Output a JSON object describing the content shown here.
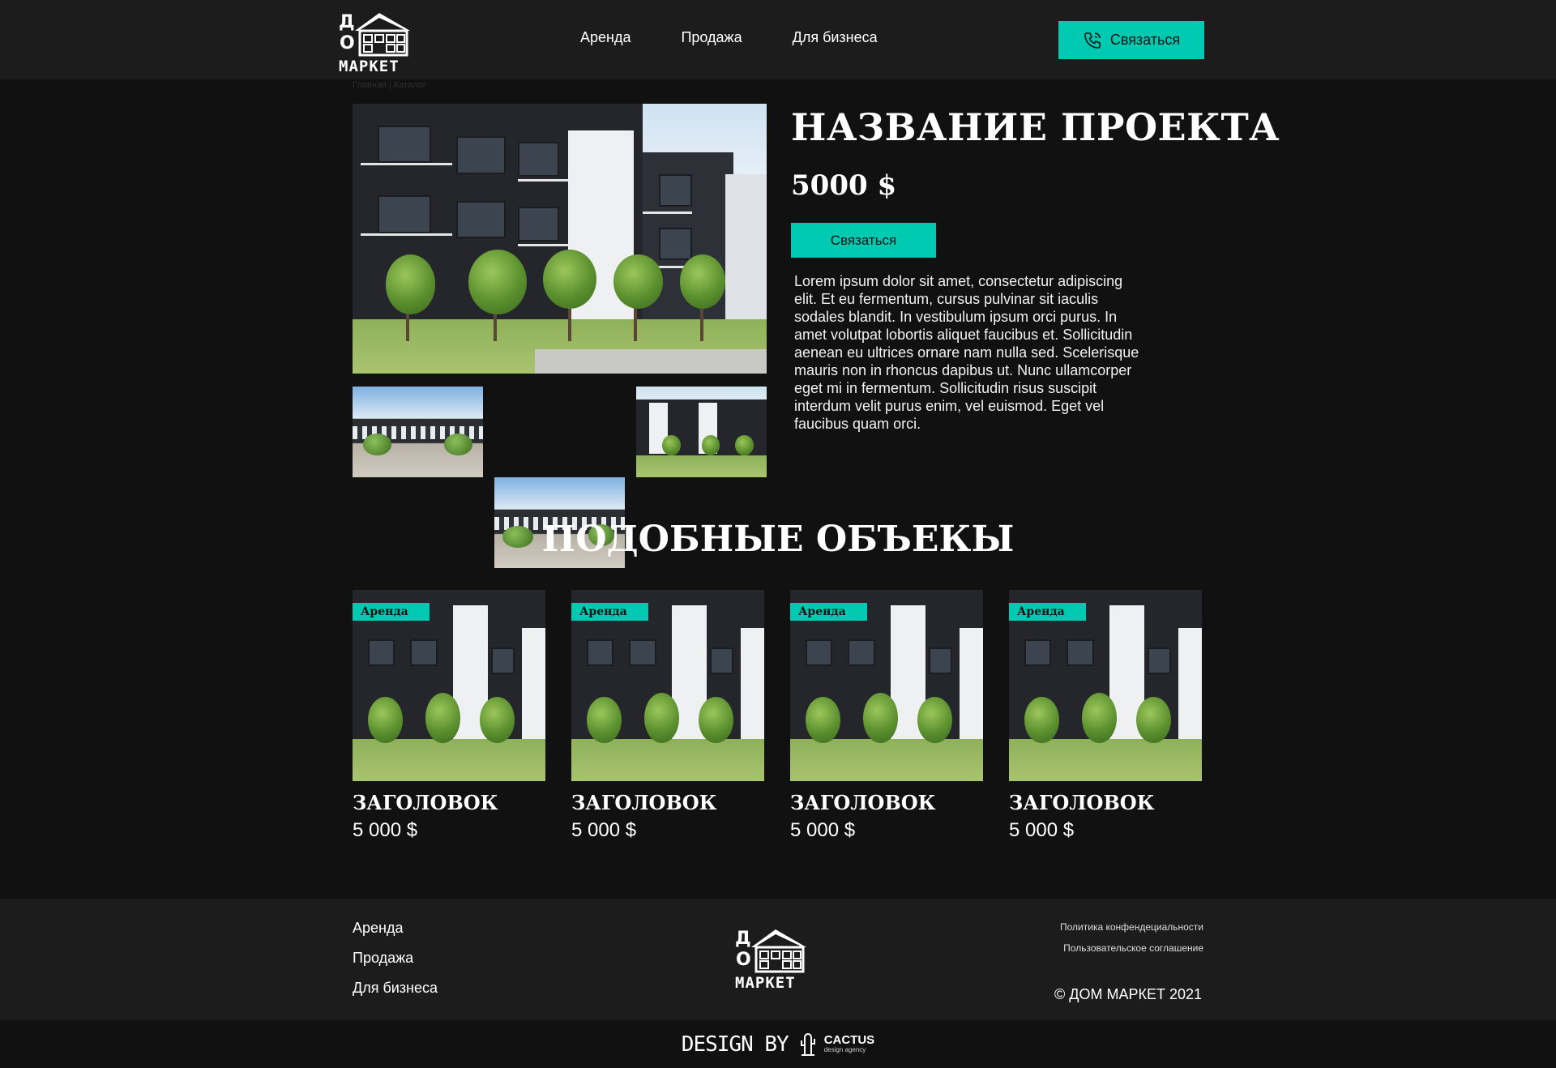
{
  "header": {
    "nav": [
      "Аренда",
      "Продажа",
      "Для бизнеса"
    ],
    "contact_label": "Связаться"
  },
  "logo": {
    "line1": "Д",
    "line2": "О",
    "word": "МАРКЕТ"
  },
  "breadcrumb": "Главная | Каталог",
  "project": {
    "title": "НАЗВАНИЕ ПРОЕКТА",
    "price": "5000 $",
    "button_label": "Связаться",
    "description": "Lorem ipsum dolor sit amet, consectetur adipiscing elit. Et eu fermentum, cursus pulvinar sit iaculis sodales blandit. In vestibulum ipsum orci purus. In amet volutpat lobortis aliquet faucibus et. Sollicitudin aenean eu ultrices ornare nam nulla sed. Scelerisque mauris non in rhoncus dapibus ut. Nunc ullamcorper eget mi in fermentum. Sollicitudin risus suscipit interdum velit purus enim, vel euismod. Eget vel faucibus quam orci."
  },
  "similar": {
    "title": "ПОДОБНЫЕ ОБЪЕКЫ",
    "cards": [
      {
        "badge": "Аренда",
        "title": "ЗАГОЛОВОК",
        "price": "5 000 $"
      },
      {
        "badge": "Аренда",
        "title": "ЗАГОЛОВОК",
        "price": "5 000 $"
      },
      {
        "badge": "Аренда",
        "title": "ЗАГОЛОВОК",
        "price": "5 000 $"
      },
      {
        "badge": "Аренда",
        "title": "ЗАГОЛОВОК",
        "price": "5 000 $"
      }
    ]
  },
  "footer": {
    "nav": [
      "Аренда",
      "Продажа",
      "Для бизнеса"
    ],
    "links": [
      "Политика конфендециальности",
      "Пользовательское соглашение"
    ],
    "copyright": "© ДОМ МАРКЕТ 2021"
  },
  "credit": {
    "text": "DESIGN BY",
    "agency": "CACTUS",
    "agency_sub": "design agency"
  },
  "colors": {
    "accent": "#00c9b2",
    "header_bg": "#1c1c1c",
    "page_bg": "#111111"
  }
}
